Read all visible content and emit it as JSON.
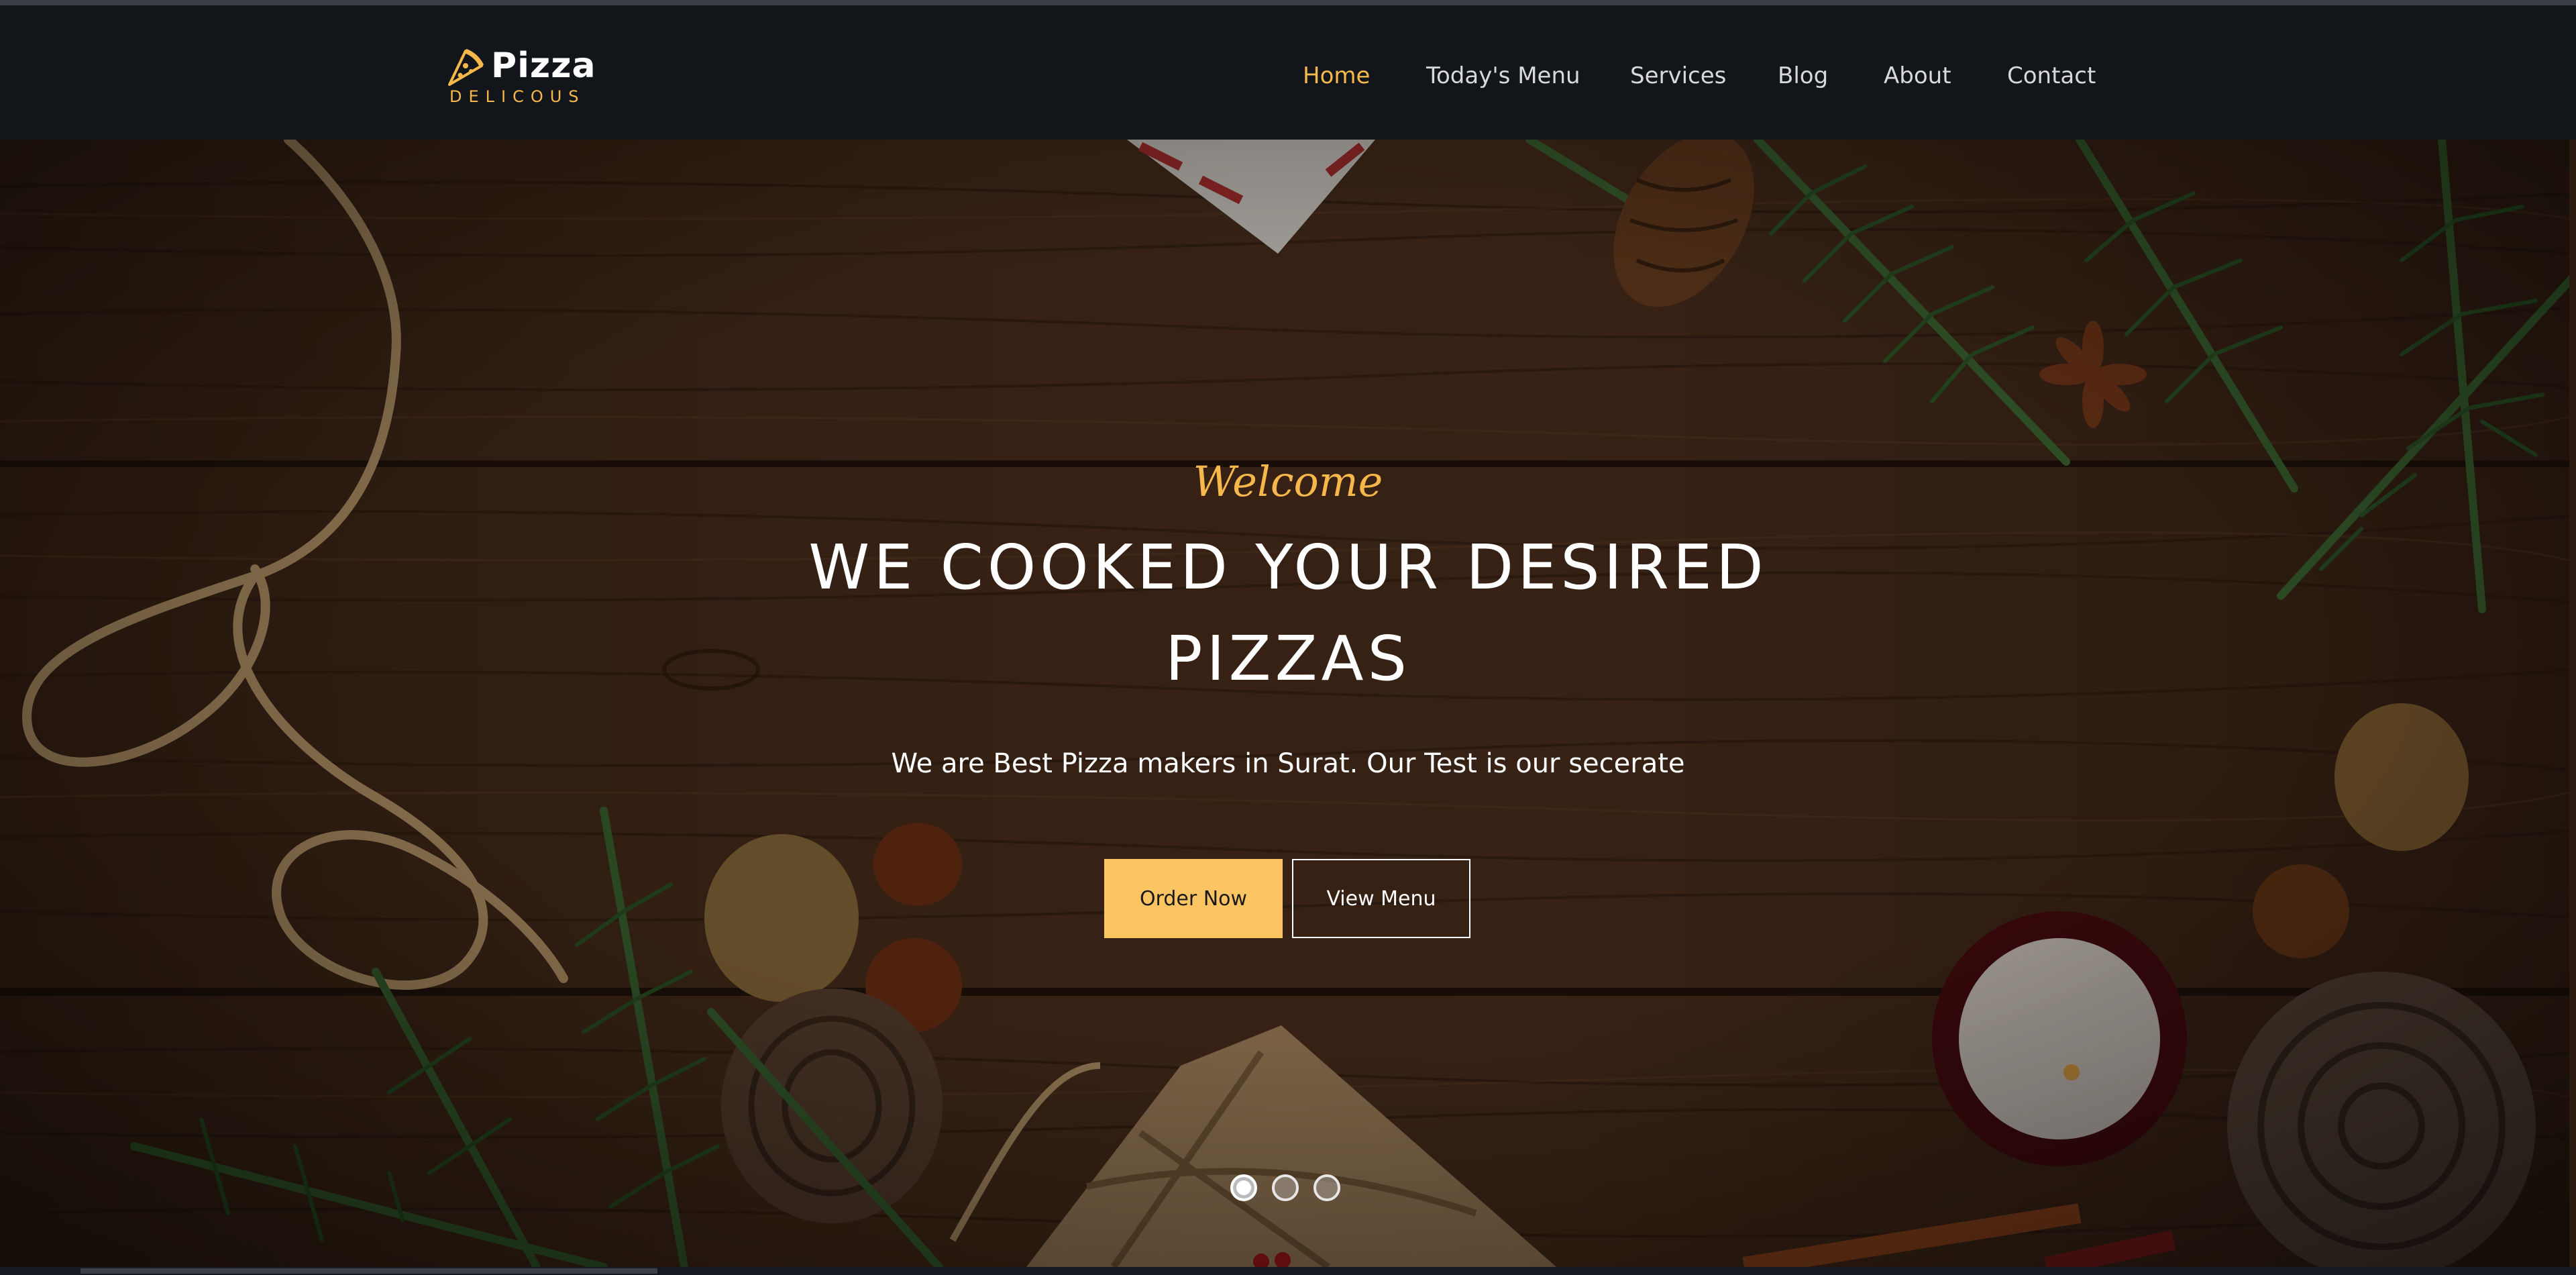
{
  "brand": {
    "title": "Pizza",
    "subtitle": "DELICOUS",
    "accent_color": "#f7b84b",
    "icon": "pizza-slice-icon"
  },
  "nav": {
    "items": [
      {
        "label": "Home",
        "active": true
      },
      {
        "label": "Today's Menu",
        "active": false
      },
      {
        "label": "Services",
        "active": false
      },
      {
        "label": "Blog",
        "active": false
      },
      {
        "label": "About",
        "active": false
      },
      {
        "label": "Contact",
        "active": false
      }
    ]
  },
  "hero": {
    "welcome": "Welcome",
    "headline": "WE COOKED YOUR DESIRED PIZZAS",
    "subtext": "We are Best Pizza makers in Surat. Our Test is our secerate",
    "order_button": "Order Now",
    "menu_button": "View Menu",
    "button_color": "#fcc462",
    "slides": {
      "count": 3,
      "active_index": 0
    }
  }
}
